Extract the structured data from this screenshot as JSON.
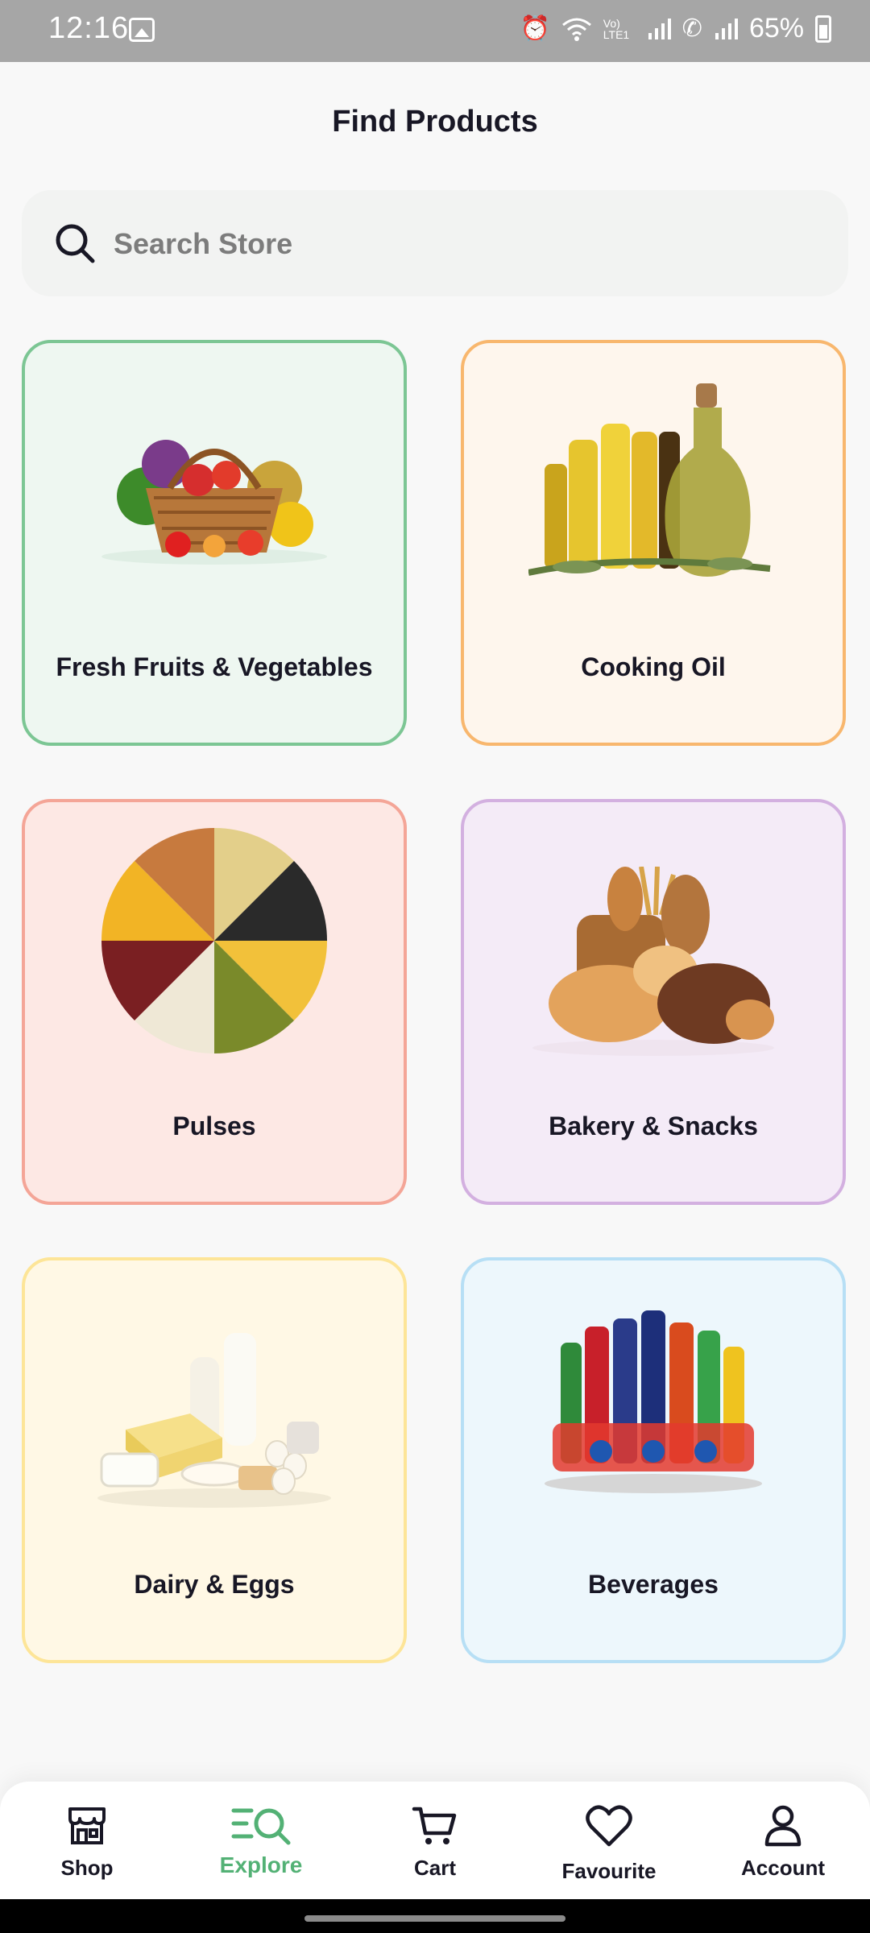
{
  "status_bar": {
    "time": "12:16",
    "network": "Vo) LTE1",
    "battery": "65%"
  },
  "page": {
    "title": "Find Products"
  },
  "search": {
    "placeholder": "Search Store"
  },
  "categories": [
    {
      "label": "Fresh Fruits & Vegetables",
      "bg": "#EEF7F1",
      "border": "#7CC694",
      "icon": "fruit-basket-icon"
    },
    {
      "label": "Cooking Oil",
      "bg": "#FEF6ED",
      "border": "#F8B76E",
      "icon": "oil-bottles-icon"
    },
    {
      "label": "Pulses",
      "bg": "#FDE8E4",
      "border": "#F4A597",
      "icon": "pulses-wheel-icon"
    },
    {
      "label": "Bakery & Snacks",
      "bg": "#F4EBF7",
      "border": "#D3B0E0",
      "icon": "bread-icon"
    },
    {
      "label": "Dairy & Eggs",
      "bg": "#FFF8E5",
      "border": "#FDE598",
      "icon": "dairy-icon"
    },
    {
      "label": "Beverages",
      "bg": "#EDF7FC",
      "border": "#B7DFF5",
      "icon": "drinks-icon"
    }
  ],
  "bottom_nav": [
    {
      "label": "Shop",
      "icon": "store-icon",
      "active": false
    },
    {
      "label": "Explore",
      "icon": "explore-icon",
      "active": true
    },
    {
      "label": "Cart",
      "icon": "cart-icon",
      "active": false
    },
    {
      "label": "Favourite",
      "icon": "heart-icon",
      "active": false
    },
    {
      "label": "Account",
      "icon": "user-icon",
      "active": false
    }
  ],
  "colors": {
    "accent": "#53B175",
    "text": "#181725"
  }
}
